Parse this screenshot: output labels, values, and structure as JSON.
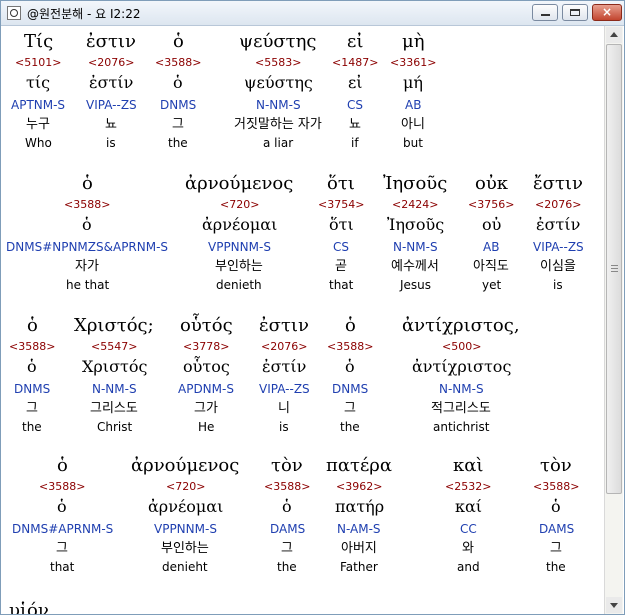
{
  "window": {
    "title": "@원전분해 - 요 I2:22",
    "icons": {
      "app": "bible-app-icon",
      "minimize": "minimize-icon",
      "maximize": "maximize-icon",
      "close": "close-icon"
    },
    "close_label": "×"
  },
  "rows": [
    {
      "words": [
        {
          "greek": "Τίς",
          "strong": "<5101>",
          "lemma": "τίς",
          "parse": "APTNM-S",
          "korean": "누구",
          "english": "Who"
        },
        {
          "greek": "ἐστιν",
          "strong": "<2076>",
          "lemma": "ἐστίν",
          "parse": "VIPA--ZS",
          "korean": "뇨",
          "english": "is"
        },
        {
          "greek": "ὁ",
          "strong": "<3588>",
          "lemma": "ὁ",
          "parse": "DNMS",
          "korean": "그",
          "english": "the"
        },
        {
          "greek": "ψεύστης",
          "strong": "<5583>",
          "lemma": "ψεύστης",
          "parse": "N-NM-S",
          "korean": "거짓말하는 자가",
          "english": "a liar"
        },
        {
          "greek": "εἰ",
          "strong": "<1487>",
          "lemma": "εἰ",
          "parse": "CS",
          "korean": "뇨",
          "english": "if"
        },
        {
          "greek": "μὴ",
          "strong": "<3361>",
          "lemma": "μή",
          "parse": "AB",
          "korean": "아니",
          "english": "but"
        }
      ]
    },
    {
      "words": [
        {
          "greek": "ὁ",
          "strong": "<3588>",
          "lemma": "ὁ",
          "parse": "DNMS#NPNMZS&APRNM-S",
          "korean": "자가",
          "english": "he that"
        },
        {
          "greek": "ἀρνούμενος",
          "strong": "<720>",
          "lemma": "ἀρνέομαι",
          "parse": "VPPNNM-S",
          "korean": "부인하는",
          "english": "denieth"
        },
        {
          "greek": "ὅτι",
          "strong": "<3754>",
          "lemma": "ὅτι",
          "parse": "CS",
          "korean": "곧",
          "english": "that"
        },
        {
          "greek": "Ἰησοῦς",
          "strong": "<2424>",
          "lemma": "Ἰησοῦς",
          "parse": "N-NM-S",
          "korean": "예수께서",
          "english": "Jesus"
        },
        {
          "greek": "οὐκ",
          "strong": "<3756>",
          "lemma": "οὐ",
          "parse": "AB",
          "korean": "아직도",
          "english": "yet"
        },
        {
          "greek": "ἔστιν",
          "strong": "<2076>",
          "lemma": "ἐστίν",
          "parse": "VIPA--ZS",
          "korean": "이심을",
          "english": "is"
        }
      ]
    },
    {
      "words": [
        {
          "greek": "ὁ",
          "strong": "<3588>",
          "lemma": "ὁ",
          "parse": "DNMS",
          "korean": "그",
          "english": "the"
        },
        {
          "greek": "Χριστός;",
          "strong": "<5547>",
          "lemma": "Χριστός",
          "parse": "N-NM-S",
          "korean": "그리스도",
          "english": "Christ"
        },
        {
          "greek": "οὗτός",
          "strong": "<3778>",
          "lemma": "οὗτος",
          "parse": "APDNM-S",
          "korean": "그가",
          "english": "He"
        },
        {
          "greek": "ἐστιν",
          "strong": "<2076>",
          "lemma": "ἐστίν",
          "parse": "VIPA--ZS",
          "korean": "니",
          "english": "is"
        },
        {
          "greek": "ὁ",
          "strong": "<3588>",
          "lemma": "ὁ",
          "parse": "DNMS",
          "korean": "그",
          "english": "the"
        },
        {
          "greek": "ἀντίχριστος,",
          "strong": "<500>",
          "lemma": "ἀντίχριστος",
          "parse": "N-NM-S",
          "korean": "적그리스도",
          "english": "antichrist"
        }
      ]
    },
    {
      "words": [
        {
          "greek": "ὁ",
          "strong": "<3588>",
          "lemma": "ὁ",
          "parse": "DNMS#APRNM-S",
          "korean": "그",
          "english": "that"
        },
        {
          "greek": "ἀρνούμενος",
          "strong": "<720>",
          "lemma": "ἀρνέομαι",
          "parse": "VPPNNM-S",
          "korean": "부인하는",
          "english": "denieht"
        },
        {
          "greek": "τὸν",
          "strong": "<3588>",
          "lemma": "ὁ",
          "parse": "DAMS",
          "korean": "그",
          "english": "the"
        },
        {
          "greek": "πατέρα",
          "strong": "<3962>",
          "lemma": "πατήρ",
          "parse": "N-AM-S",
          "korean": "아버지",
          "english": "Father"
        },
        {
          "greek": "καὶ",
          "strong": "<2532>",
          "lemma": "καί",
          "parse": "CC",
          "korean": "와",
          "english": "and"
        },
        {
          "greek": "τὸν",
          "strong": "<3588>",
          "lemma": "ὁ",
          "parse": "DAMS",
          "korean": "그",
          "english": "the"
        }
      ]
    }
  ],
  "partial_next_word": "υἱόν"
}
